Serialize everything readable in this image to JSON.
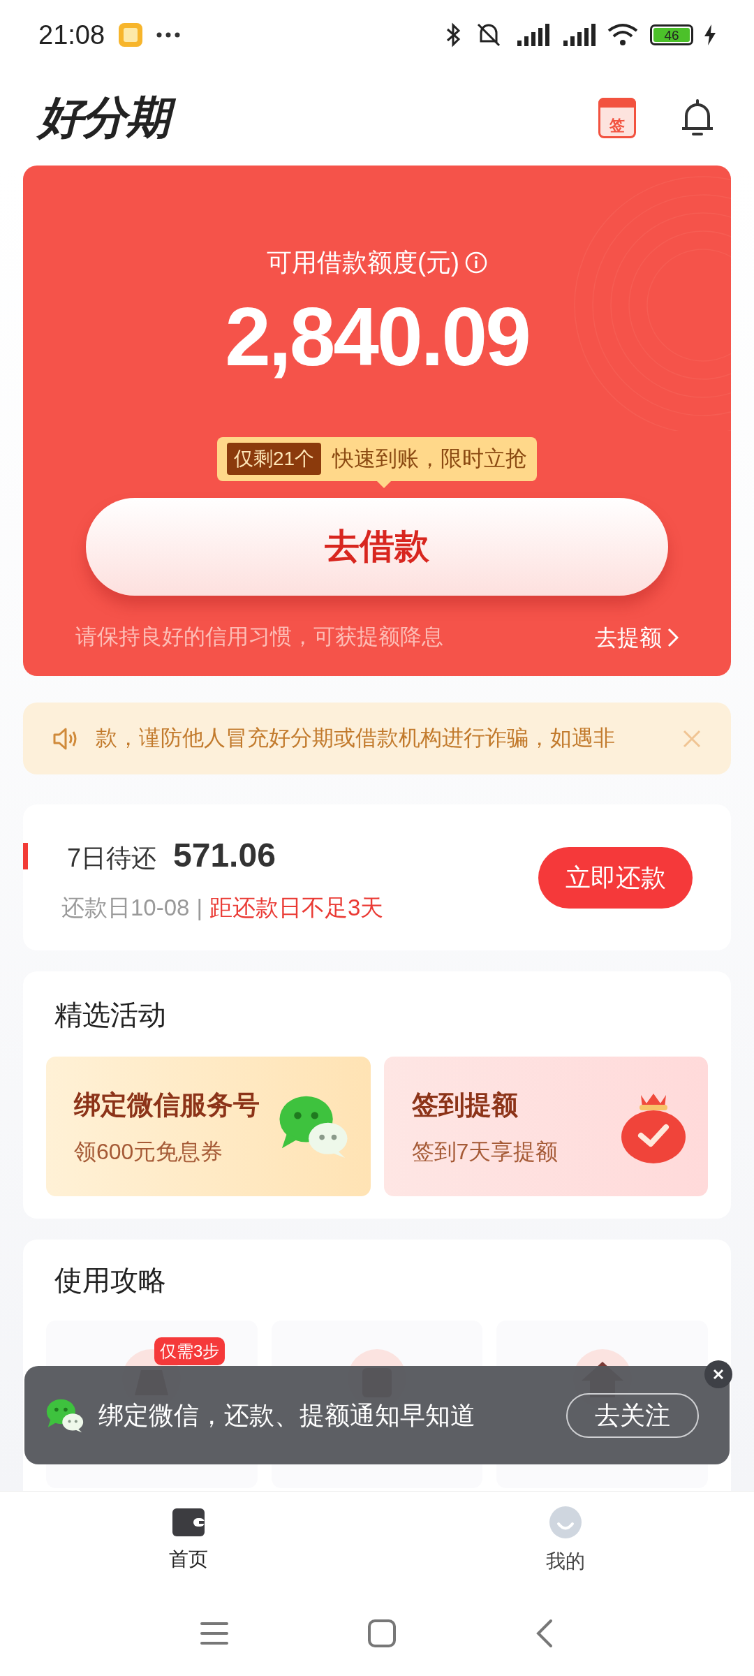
{
  "status_bar": {
    "time": "21:08",
    "battery": "46"
  },
  "header": {
    "logo": "好分期",
    "calendar_badge": "签"
  },
  "credit_card": {
    "label": "可用借款额度(元)",
    "amount": "2,840.09",
    "promo_badge": "仅剩21个",
    "promo_text": "快速到账，限时立抢",
    "button": "去借款",
    "hint": "请保持良好的信用习惯，可获提额降息",
    "link": "去提额"
  },
  "notice": {
    "text": "款，谨防他人冒充好分期或借款机构进行诈骗，如遇非"
  },
  "repayment": {
    "title": "7日待还",
    "amount": "571.06",
    "date": "还款日10-08",
    "separator": "|",
    "warning": "距还款日不足3天",
    "button": "立即还款"
  },
  "activities": {
    "title": "精选活动",
    "items": [
      {
        "kind": "wechat",
        "title": "绑定微信服务号",
        "subtitle": "领600元免息券"
      },
      {
        "kind": "checkin",
        "title": "签到提额",
        "subtitle": "签到7天享提额"
      }
    ]
  },
  "guide": {
    "title": "使用攻略",
    "items": [
      {
        "kind": "bag",
        "badge": "仅需3步"
      },
      {
        "kind": "card"
      },
      {
        "kind": "house"
      }
    ]
  },
  "toast": {
    "text": "绑定微信，还款、提额通知早知道",
    "button": "去关注"
  },
  "tab_bar": [
    {
      "kind": "wallet",
      "label": "首页",
      "selected": true
    },
    {
      "kind": "face",
      "label": "我的",
      "selected": false
    }
  ]
}
